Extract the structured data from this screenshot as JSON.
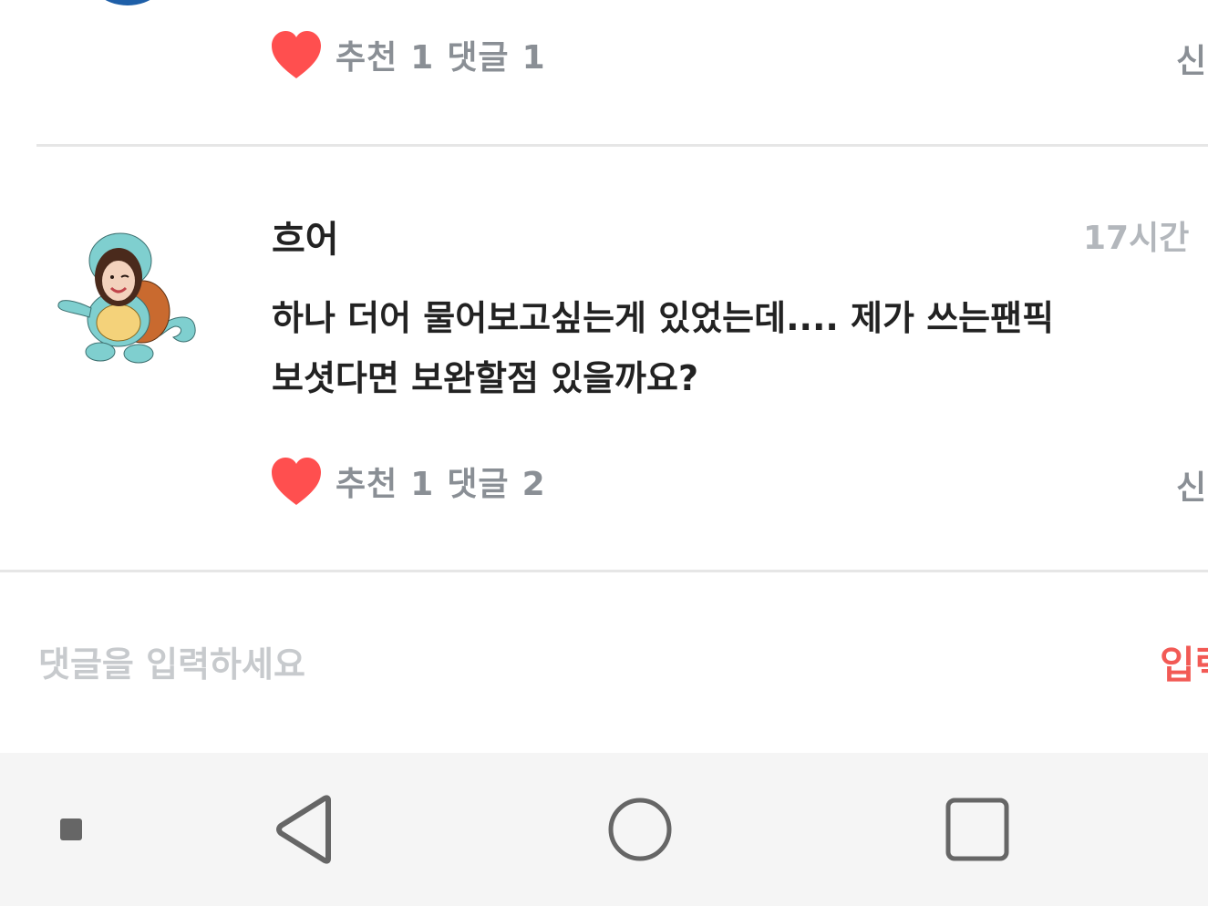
{
  "prev_comment": {
    "recommend_label": "추천",
    "recommend_count": "1",
    "reply_label": "댓글",
    "reply_count": "1",
    "report_label": "신"
  },
  "comment": {
    "author": "흐어",
    "time": "17시간 ",
    "text_line1": "하나 더어 물어보고싶는게 있었는데.... 제가 쓰는팬픽",
    "text_line2": "보셧다면 보완할점 있을까요?",
    "recommend_label": "추천",
    "recommend_count": "1",
    "reply_label": "댓글",
    "reply_count": "2",
    "report_label": "신"
  },
  "input": {
    "placeholder": "댓글을 입력하세요",
    "submit_label": "입력"
  },
  "icons": {
    "heart": "heart-icon",
    "back": "back-triangle-icon",
    "home": "home-circle-icon",
    "recents": "recents-square-icon",
    "menu": "small-square-icon"
  },
  "colors": {
    "heart": "#ff4f4f",
    "submit": "#f25a55",
    "muted": "#8a8f95",
    "placeholder": "#c7cacd"
  }
}
